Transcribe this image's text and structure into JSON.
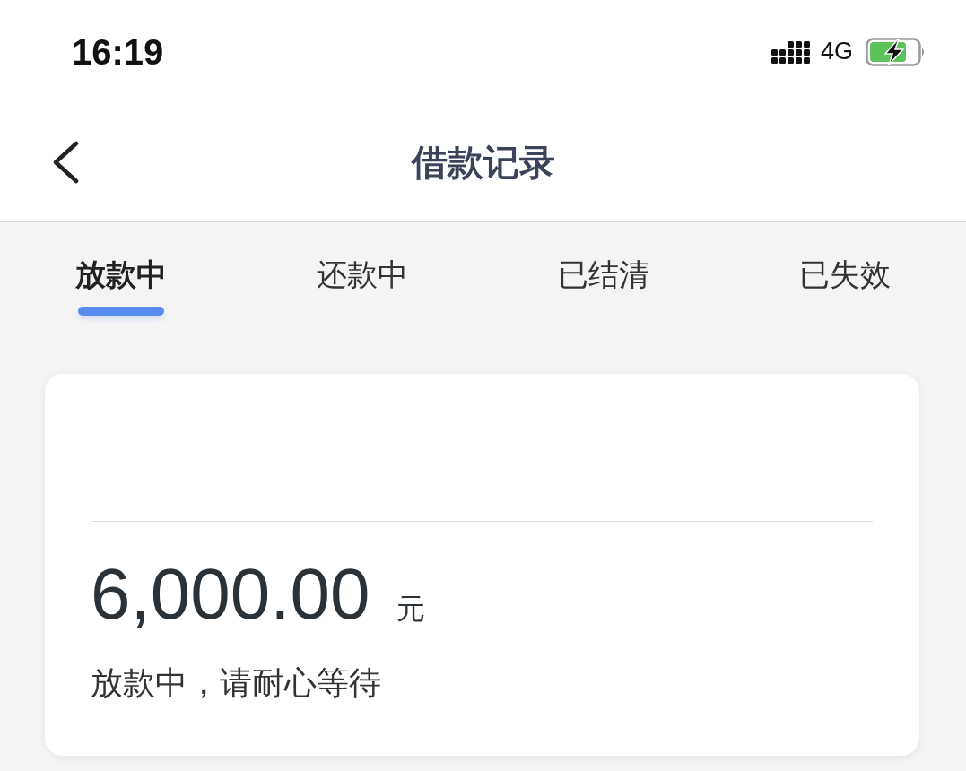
{
  "status_bar": {
    "time": "16:19",
    "network": "4G"
  },
  "nav_bar": {
    "title": "借款记录"
  },
  "tabs": [
    {
      "label": "放款中",
      "selected": true
    },
    {
      "label": "还款中",
      "selected": false
    },
    {
      "label": "已结清",
      "selected": false
    },
    {
      "label": "已失效",
      "selected": false
    }
  ],
  "loan_card": {
    "amount": "6,000.00",
    "unit": "元",
    "status_message": "放款中，请耐心等待"
  }
}
